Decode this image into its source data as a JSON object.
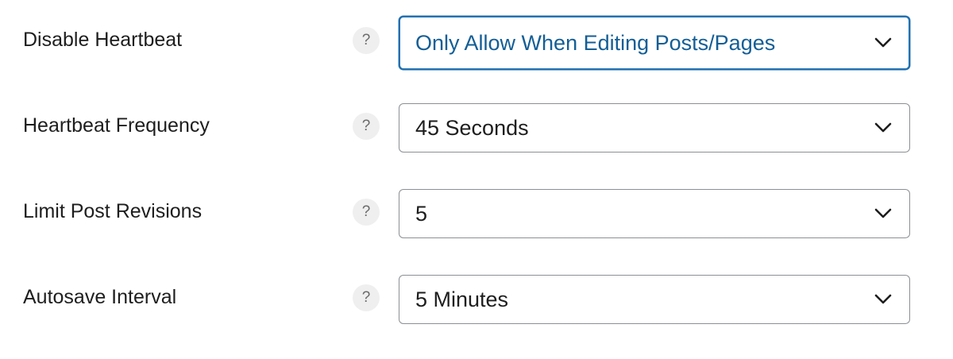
{
  "settings": [
    {
      "label": "Disable Heartbeat",
      "help": "?",
      "value": "Only Allow When Editing Posts/Pages",
      "focused": true
    },
    {
      "label": "Heartbeat Frequency",
      "help": "?",
      "value": "45 Seconds",
      "focused": false
    },
    {
      "label": "Limit Post Revisions",
      "help": "?",
      "value": "5",
      "focused": false
    },
    {
      "label": "Autosave Interval",
      "help": "?",
      "value": "5 Minutes",
      "focused": false
    }
  ],
  "colors": {
    "focus_border": "#2271b1",
    "focus_text": "#135e96",
    "border": "#8c8f94",
    "help_bg": "#efefef",
    "text": "#1e1e1e"
  },
  "icons": {
    "help": "question-mark-icon",
    "dropdown": "chevron-down-icon"
  }
}
